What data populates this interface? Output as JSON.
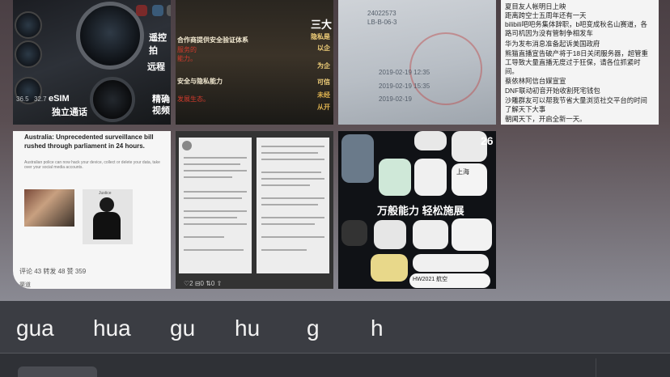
{
  "gallery": {
    "tile1": {
      "labels": [
        "遥控拍",
        "远程",
        "eSIM",
        "独立通话",
        "视频",
        "精确"
      ],
      "dial_readouts": [
        "36.5",
        "32.7"
      ]
    },
    "tile2": {
      "lines": [
        "合作商提供安全验证体系",
        "服务的",
        "能力。",
        "安全与隐私能力",
        "发展生态。"
      ],
      "side_title": "三大",
      "side_lines": [
        "隐私是",
        "以企",
        "为企",
        "可信",
        "未经",
        "从开"
      ]
    },
    "tile3": {
      "lines": [
        "24022573",
        "LB-B-06-3",
        "2019-02-19 12:35",
        "2019-02-19 15:35",
        "2019-02-19"
      ]
    },
    "tile4": {
      "lines": [
        "夏目友人帐明日上映",
        "距离跨空士五周年还有一天",
        "bilibili吧吧务集体辞职，b吧变成秋名山赛道，各",
        "路司机因为没有管制争相发车",
        "华为发布消息准备起诉美国政府",
        "熊猫直播宣告破产将于18日关闭服务器，超管重",
        "工导致大量直播无度过于狂保，请各位抓紧时",
        "间。",
        "蔡依林阿信台媒宣宣",
        "DNF联动初音开始收割死宅钱包",
        "沙雕群友可以帮我节省大量浏览社交平台的时间",
        "了解天下大事",
        "朝闻天下，开启全新一天。"
      ]
    },
    "tile5": {
      "headline": "Australia: Unprecedented surveillance bill rushed through parliament in 24 hours.",
      "subline": "Australian police can now hack your device, collect or delete your data, take over your social media accounts.",
      "photo_caption": "Justice",
      "stats": "评论 43    转发 48    赞 359",
      "author": "渠道"
    },
    "tile6": {
      "stats": "♡2    ⊟0    ⇅0    ⇧"
    },
    "tile7": {
      "headline": "万般能力 轻松施展",
      "city": "上海",
      "temperature": "26",
      "flight": "HW2021 航空"
    }
  },
  "candidates": [
    "gua",
    "hua",
    "gu",
    "hu",
    "g",
    "h"
  ]
}
